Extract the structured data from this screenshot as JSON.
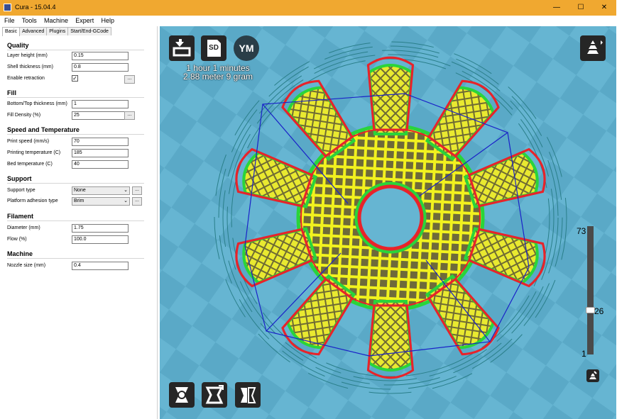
{
  "window": {
    "title": "Cura - 15.04.4",
    "minimize": "—",
    "maximize": "☐",
    "close": "✕"
  },
  "menu": [
    "File",
    "Tools",
    "Machine",
    "Expert",
    "Help"
  ],
  "tabs": [
    "Basic",
    "Advanced",
    "Plugins",
    "Start/End-GCode"
  ],
  "sections": {
    "quality": {
      "title": "Quality",
      "layer_height_label": "Layer height (mm)",
      "layer_height": "0.15",
      "shell_label": "Shell thickness (mm)",
      "shell": "0.8",
      "retraction_label": "Enable retraction",
      "retraction_checked": "✓"
    },
    "fill": {
      "title": "Fill",
      "bottomtop_label": "Bottom/Top thickness (mm)",
      "bottomtop": "1",
      "density_label": "Fill Density (%)",
      "density": "25"
    },
    "speed": {
      "title": "Speed and Temperature",
      "print_speed_label": "Print speed (mm/s)",
      "print_speed": "70",
      "print_temp_label": "Printing temperature (C)",
      "print_temp": "185",
      "bed_temp_label": "Bed temperature (C)",
      "bed_temp": "40"
    },
    "support": {
      "title": "Support",
      "support_type_label": "Support type",
      "support_type": "None",
      "adhesion_label": "Platform adhesion type",
      "adhesion": "Brim"
    },
    "filament": {
      "title": "Filament",
      "diameter_label": "Diameter (mm)",
      "diameter": "1.75",
      "flow_label": "Flow (%)",
      "flow": "100.0"
    },
    "machine": {
      "title": "Machine",
      "nozzle_label": "Nozzle size (mm)",
      "nozzle": "0.4"
    }
  },
  "dots_label": "...",
  "viewport": {
    "print_time": "1 hour 1 minutes",
    "print_amount": "2.88 meter 9 gram",
    "sd_label": "SD",
    "ym_label": "YM",
    "layer_max": "73",
    "layer_current": "26",
    "layer_min": "1",
    "layer_fraction": 0.35
  },
  "icons": {
    "load": "load-model-icon",
    "sd": "save-sd-icon",
    "ym": "youmagine-icon",
    "view_mode": "view-mode-icon",
    "rotate": "rotate-icon",
    "scale": "scale-icon",
    "mirror": "mirror-icon",
    "layer_icon": "layer-icon"
  },
  "colors": {
    "titlebar": "#f0a830",
    "viewport": "#66b5d2",
    "wall_outer": "#e8232a",
    "wall_inner": "#2ad43a",
    "infill": "#f2f21e",
    "travel": "#1a22c8",
    "skirt": "#2a7f8a"
  }
}
